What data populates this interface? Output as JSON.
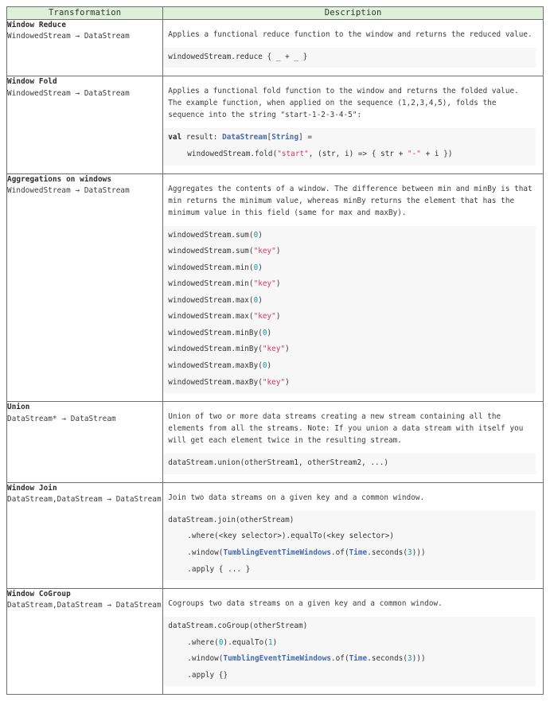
{
  "table": {
    "headers": {
      "transformation": "Transformation",
      "description": "Description"
    },
    "colors": {
      "header_background": "#dff0d8",
      "border": "#6f6f6f",
      "code_background": "#f7f7f7",
      "keyword": "#2b2b2b",
      "type": "#4169b0",
      "string": "#d6336c",
      "number": "#0b9a9a",
      "text": "#333333"
    },
    "rows": [
      {
        "name": "Window Reduce",
        "signature": "WindowedStream → DataStream",
        "description": "Applies a functional reduce function to the window and returns the reduced value.",
        "code": [
          {
            "indent": false,
            "tokens": [
              {
                "t": "windowedStream.reduce { _ + _ }",
                "c": "plain"
              }
            ]
          }
        ]
      },
      {
        "name": "Window Fold",
        "signature": "WindowedStream → DataStream",
        "description": "Applies a functional fold function to the window and returns the folded value. The example function, when applied on the sequence (1,2,3,4,5), folds the sequence into the string \"start-1-2-3-4-5\":",
        "code": [
          {
            "indent": false,
            "tokens": [
              {
                "t": "val",
                "c": "kw"
              },
              {
                "t": " result: ",
                "c": "plain"
              },
              {
                "t": "DataStream",
                "c": "typ"
              },
              {
                "t": "[",
                "c": "plain"
              },
              {
                "t": "String",
                "c": "typ"
              },
              {
                "t": "] =",
                "c": "plain"
              }
            ]
          },
          {
            "indent": true,
            "tokens": [
              {
                "t": "windowedStream.fold(",
                "c": "plain"
              },
              {
                "t": "\"start\"",
                "c": "str"
              },
              {
                "t": ", (str, i) => { str + ",
                "c": "plain"
              },
              {
                "t": "\"-\"",
                "c": "str"
              },
              {
                "t": " + i })",
                "c": "plain"
              }
            ]
          }
        ]
      },
      {
        "name": "Aggregations on windows",
        "signature": "WindowedStream → DataStream",
        "description": "Aggregates the contents of a window. The difference between min and minBy is that min returns the minimum value, whereas minBy returns the element that has the minimum value in this field (same for max and maxBy).",
        "code": [
          {
            "indent": false,
            "tokens": [
              {
                "t": "windowedStream.sum(",
                "c": "plain"
              },
              {
                "t": "0",
                "c": "num"
              },
              {
                "t": ")",
                "c": "plain"
              }
            ]
          },
          {
            "indent": false,
            "tokens": [
              {
                "t": "windowedStream.sum(",
                "c": "plain"
              },
              {
                "t": "\"key\"",
                "c": "str"
              },
              {
                "t": ")",
                "c": "plain"
              }
            ]
          },
          {
            "indent": false,
            "tokens": [
              {
                "t": "windowedStream.min(",
                "c": "plain"
              },
              {
                "t": "0",
                "c": "num"
              },
              {
                "t": ")",
                "c": "plain"
              }
            ]
          },
          {
            "indent": false,
            "tokens": [
              {
                "t": "windowedStream.min(",
                "c": "plain"
              },
              {
                "t": "\"key\"",
                "c": "str"
              },
              {
                "t": ")",
                "c": "plain"
              }
            ]
          },
          {
            "indent": false,
            "tokens": [
              {
                "t": "windowedStream.max(",
                "c": "plain"
              },
              {
                "t": "0",
                "c": "num"
              },
              {
                "t": ")",
                "c": "plain"
              }
            ]
          },
          {
            "indent": false,
            "tokens": [
              {
                "t": "windowedStream.max(",
                "c": "plain"
              },
              {
                "t": "\"key\"",
                "c": "str"
              },
              {
                "t": ")",
                "c": "plain"
              }
            ]
          },
          {
            "indent": false,
            "tokens": [
              {
                "t": "windowedStream.minBy(",
                "c": "plain"
              },
              {
                "t": "0",
                "c": "num"
              },
              {
                "t": ")",
                "c": "plain"
              }
            ]
          },
          {
            "indent": false,
            "tokens": [
              {
                "t": "windowedStream.minBy(",
                "c": "plain"
              },
              {
                "t": "\"key\"",
                "c": "str"
              },
              {
                "t": ")",
                "c": "plain"
              }
            ]
          },
          {
            "indent": false,
            "tokens": [
              {
                "t": "windowedStream.maxBy(",
                "c": "plain"
              },
              {
                "t": "0",
                "c": "num"
              },
              {
                "t": ")",
                "c": "plain"
              }
            ]
          },
          {
            "indent": false,
            "tokens": [
              {
                "t": "windowedStream.maxBy(",
                "c": "plain"
              },
              {
                "t": "\"key\"",
                "c": "str"
              },
              {
                "t": ")",
                "c": "plain"
              }
            ]
          }
        ]
      },
      {
        "name": "Union",
        "signature": "DataStream* → DataStream",
        "description": "Union of two or more data streams creating a new stream containing all the elements from all the streams. Note: If you union a data stream with itself you will get each element twice in the resulting stream.",
        "code": [
          {
            "indent": false,
            "tokens": [
              {
                "t": "dataStream.union(otherStream1, otherStream2, ...)",
                "c": "plain"
              }
            ]
          }
        ]
      },
      {
        "name": "Window Join",
        "signature": "DataStream,DataStream → DataStream",
        "description": "Join two data streams on a given key and a common window.",
        "code": [
          {
            "indent": false,
            "tokens": [
              {
                "t": "dataStream.join(otherStream)",
                "c": "plain"
              }
            ]
          },
          {
            "indent": true,
            "tokens": [
              {
                "t": ".where(<key selector>).equalTo(<key selector>)",
                "c": "plain"
              }
            ]
          },
          {
            "indent": true,
            "tokens": [
              {
                "t": ".window(",
                "c": "plain"
              },
              {
                "t": "TumblingEventTimeWindows",
                "c": "typ"
              },
              {
                "t": ".of(",
                "c": "plain"
              },
              {
                "t": "Time",
                "c": "typ"
              },
              {
                "t": ".seconds(",
                "c": "plain"
              },
              {
                "t": "3",
                "c": "num"
              },
              {
                "t": ")))",
                "c": "plain"
              }
            ]
          },
          {
            "indent": true,
            "tokens": [
              {
                "t": ".apply { ... }",
                "c": "plain"
              }
            ]
          }
        ]
      },
      {
        "name": "Window CoGroup",
        "signature": "DataStream,DataStream → DataStream",
        "description": "Cogroups two data streams on a given key and a common window.",
        "code": [
          {
            "indent": false,
            "tokens": [
              {
                "t": "dataStream.coGroup(otherStream)",
                "c": "plain"
              }
            ]
          },
          {
            "indent": true,
            "tokens": [
              {
                "t": ".where(",
                "c": "plain"
              },
              {
                "t": "0",
                "c": "num"
              },
              {
                "t": ").equalTo(",
                "c": "plain"
              },
              {
                "t": "1",
                "c": "num"
              },
              {
                "t": ")",
                "c": "plain"
              }
            ]
          },
          {
            "indent": true,
            "tokens": [
              {
                "t": ".window(",
                "c": "plain"
              },
              {
                "t": "TumblingEventTimeWindows",
                "c": "typ"
              },
              {
                "t": ".of(",
                "c": "plain"
              },
              {
                "t": "Time",
                "c": "typ"
              },
              {
                "t": ".seconds(",
                "c": "plain"
              },
              {
                "t": "3",
                "c": "num"
              },
              {
                "t": ")))",
                "c": "plain"
              }
            ]
          },
          {
            "indent": true,
            "tokens": [
              {
                "t": ".apply {}",
                "c": "plain"
              }
            ]
          }
        ]
      }
    ]
  }
}
